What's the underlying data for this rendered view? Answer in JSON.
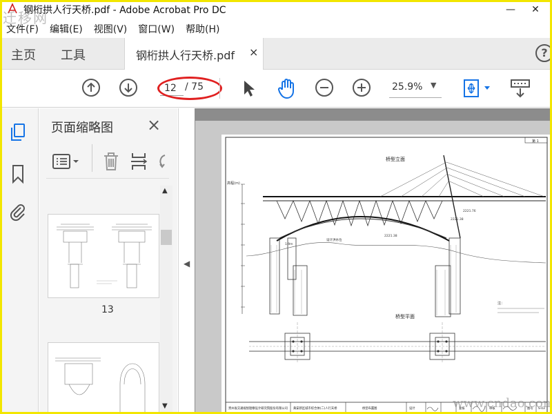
{
  "window": {
    "title": "钢桁拱人行天桥.pdf - Adobe Acrobat Pro DC",
    "minimize_icon": "minimize-icon",
    "close_icon": "close-icon"
  },
  "watermarks": {
    "top_left": "迁移网",
    "bottom_right": "www.cndao.com"
  },
  "menu": [
    "文件(F)",
    "编辑(E)",
    "视图(V)",
    "窗口(W)",
    "帮助(H)"
  ],
  "tabs": {
    "home": "主页",
    "tools": "工具",
    "document": "钢桁拱人行天桥.pdf",
    "close": "×",
    "help": "?"
  },
  "toolbar": {
    "current_page": "12",
    "total_pages": "/ 75",
    "zoom": "25.9%",
    "icons": [
      "page-up-icon",
      "page-down-icon",
      "select-arrow-icon",
      "hand-icon",
      "zoom-out-icon",
      "zoom-in-icon",
      "fit-page-icon",
      "scrolling-mode-icon"
    ]
  },
  "sidebar": {
    "panel_title": "页面缩略图",
    "panel_close": "×",
    "thumbnails": [
      {
        "page": "13"
      }
    ]
  },
  "drawing": {
    "title_elevation": "桥型立面",
    "title_plan": "桥型平面",
    "note": "注：",
    "title_block": {
      "company": "贵州省交通规划勘察设计研究院股份有限公司",
      "project": "黄安新区城市综合体(二)人行天桥",
      "drawing": "桥型布置图",
      "design": "设计",
      "review": "复核",
      "approve": "审核",
      "drawing_no_label": "图号",
      "drawing_no": "S-03"
    }
  },
  "colors": {
    "accent_blue": "#1473e6",
    "annotation_red": "#e02020",
    "frame_yellow": "#f2e600"
  }
}
